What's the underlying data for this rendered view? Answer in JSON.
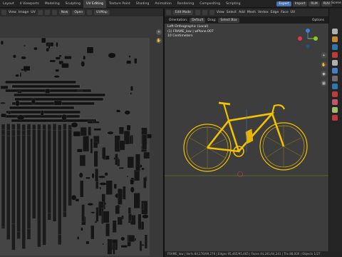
{
  "workspace_tabs": [
    "Layout",
    "4 Viewports",
    "Modeling",
    "Sculpting",
    "UV Editing",
    "Texture Paint",
    "Shading",
    "Animation",
    "Rendering",
    "Compositing",
    "Scripting"
  ],
  "active_tab": "UV Editing",
  "topbar": {
    "export": "Export",
    "import": "Import",
    "rlm": "RLM",
    "ruv": "RUV",
    "scene": "Scene"
  },
  "uv_header": {
    "mode_icon": "uv-sync-icon",
    "view": "View",
    "image": "Image",
    "uv": "UV",
    "new": "New",
    "open": "Open",
    "uvmap": "UVMap"
  },
  "vp_header": {
    "mode": "Edit Mode",
    "view": "View",
    "select": "Select",
    "add": "Add",
    "mesh": "Mesh",
    "vertex": "Vertex",
    "edge": "Edge",
    "face": "Face",
    "uv": "UV"
  },
  "vp_header2": {
    "orientation_label": "Orientation:",
    "orientation": "Default",
    "drag_label": "Drag:",
    "drag": "Select Box",
    "options": "Options"
  },
  "viewport_info": {
    "line1": "Left Orthographic (Local)",
    "line2": "(1) FRAME_low | wPlane.007",
    "line3": "10 Centimeters"
  },
  "status_bar": "FRAME_low | Verts 84,276/99,276 | Edges 95,465/95,465 | Faces 44,241/44,241 | Tris 88,000 | Objects 1/27",
  "colors": {
    "accent": "#4772b3",
    "mesh": "#f2c200",
    "axis_x": "#e2364d",
    "axis_y": "#8acb28",
    "axis_z": "#3d7cd9"
  }
}
